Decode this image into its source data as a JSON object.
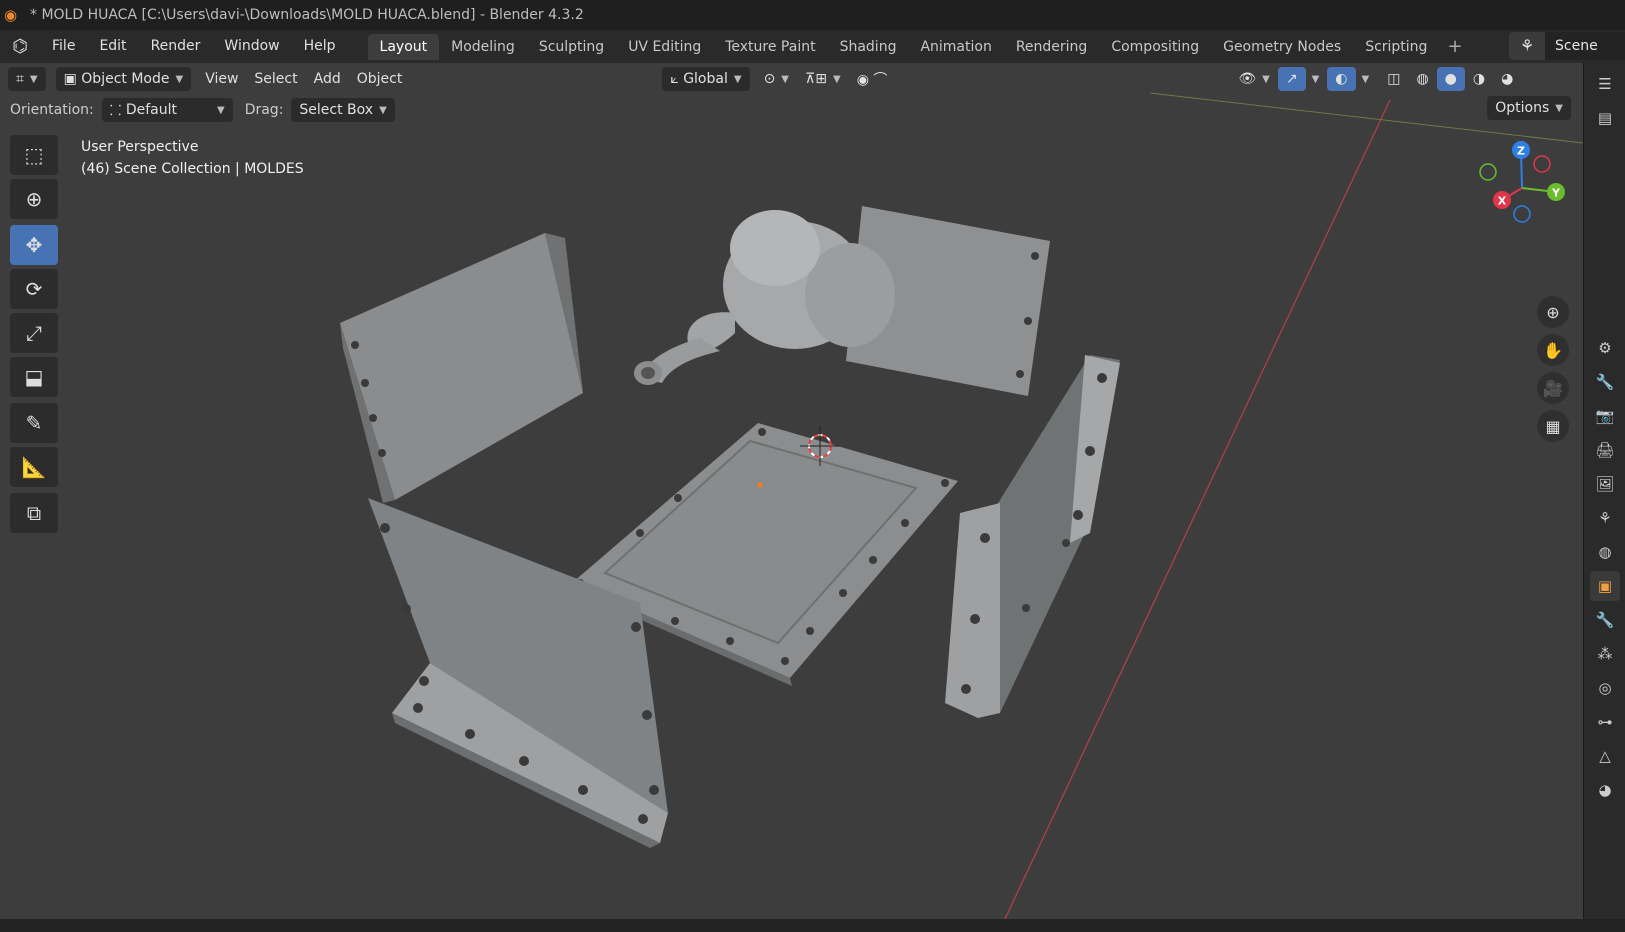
{
  "window": {
    "title": "* MOLD HUACA [C:\\Users\\davi-\\Downloads\\MOLD HUACA.blend] - Blender 4.3.2"
  },
  "menu": [
    "File",
    "Edit",
    "Render",
    "Window",
    "Help"
  ],
  "workspaces": [
    "Layout",
    "Modeling",
    "Sculpting",
    "UV Editing",
    "Texture Paint",
    "Shading",
    "Animation",
    "Rendering",
    "Compositing",
    "Geometry Nodes",
    "Scripting"
  ],
  "scene": {
    "label": "Scene"
  },
  "viewport_header": {
    "mode": "Object Mode",
    "menus": [
      "View",
      "Select",
      "Add",
      "Object"
    ],
    "transform_orientation": "Global"
  },
  "tool_options": {
    "orientation_label": "Orientation:",
    "orientation_value": "Default",
    "drag_label": "Drag:",
    "drag_value": "Select Box",
    "options_label": "Options"
  },
  "overlay": {
    "view_name": "User Perspective",
    "collection": "(46) Scene Collection | MOLDES"
  },
  "gizmo": {
    "x": "X",
    "y": "Y",
    "z": "Z",
    "colors": {
      "x": "#e0364b",
      "y": "#6bbd2e",
      "z": "#2f7fe6"
    }
  },
  "colors": {
    "accent": "#4772b3",
    "viewport_bg": "#3d3d3d",
    "object_active": "#f0a040"
  }
}
